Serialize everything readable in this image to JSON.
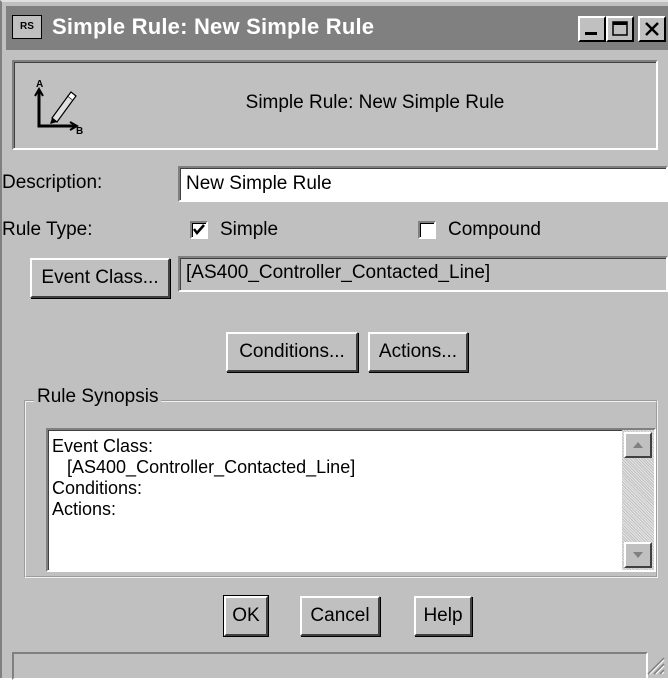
{
  "window": {
    "title": "Simple Rule: New Simple Rule",
    "icon_name": "application-icon"
  },
  "header": {
    "icon_name": "rule-ab-icon",
    "title": "Simple Rule: New Simple Rule"
  },
  "form": {
    "description_label": "Description:",
    "description_value": "New Simple Rule",
    "rule_type_label": "Rule Type:",
    "simple_label": "Simple",
    "simple_checked": true,
    "compound_label": "Compound",
    "compound_checked": false,
    "event_class_button": "Event Class...",
    "event_class_value": "[AS400_Controller_Contacted_Line]"
  },
  "buttons": {
    "conditions": "Conditions...",
    "actions": "Actions...",
    "ok": "OK",
    "cancel": "Cancel",
    "help": "Help"
  },
  "synopsis": {
    "group_label": "Rule Synopsis",
    "line1": "Event Class:",
    "line2": "[AS400_Controller_Contacted_Line]",
    "line3": "Conditions:",
    "line4": "Actions:"
  },
  "colors": {
    "face": "#c0c0c0",
    "titlebar_inactive": "#808080"
  }
}
